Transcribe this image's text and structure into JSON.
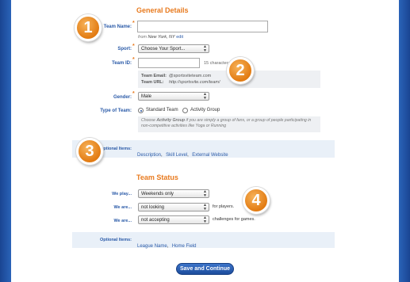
{
  "general": {
    "title": "General Details",
    "team_name_label": "Team Name:",
    "from_prefix": "from",
    "from_location": "New York, NY",
    "edit_link": "edit",
    "sport_label": "Sport:",
    "sport_value": "Choose Your Sport...",
    "team_id_label": "Team ID:",
    "team_id_hint": "15 characters left",
    "team_email_label": "Team Email:",
    "team_email_value": "@sportsviteteam.com",
    "team_url_label": "Team URL:",
    "team_url_value": "http://sportsvite.com/team/",
    "gender_label": "Gender:",
    "gender_value": "Male",
    "type_label": "Type of Team:",
    "type_options": [
      "Standard Team",
      "Activity Group"
    ],
    "activity_note_pre": "Choose ",
    "activity_note_strong": "Activity Group",
    "activity_note_post": " if you are simply a group of fans, or a group of people participating in non-competitive activities like Yoga or Running",
    "optional_label": "Optional Items:",
    "optional_links": [
      "Description",
      "Skill Level",
      "External Website"
    ]
  },
  "status": {
    "title": "Team Status",
    "we_play_label": "We play...",
    "we_play_value": "Weekends only",
    "we_are_label_1": "We are...",
    "we_are_value_1": "not looking",
    "suffix_1": "for players.",
    "we_are_label_2": "We are...",
    "we_are_value_2": "not accepting",
    "suffix_2": "challenges for games.",
    "optional_label": "Optional Items:",
    "optional_links": [
      "League Name",
      "Home Field"
    ]
  },
  "badges": [
    "1",
    "2",
    "3",
    "4"
  ],
  "save_label": "Save and Continue",
  "separator": ","
}
